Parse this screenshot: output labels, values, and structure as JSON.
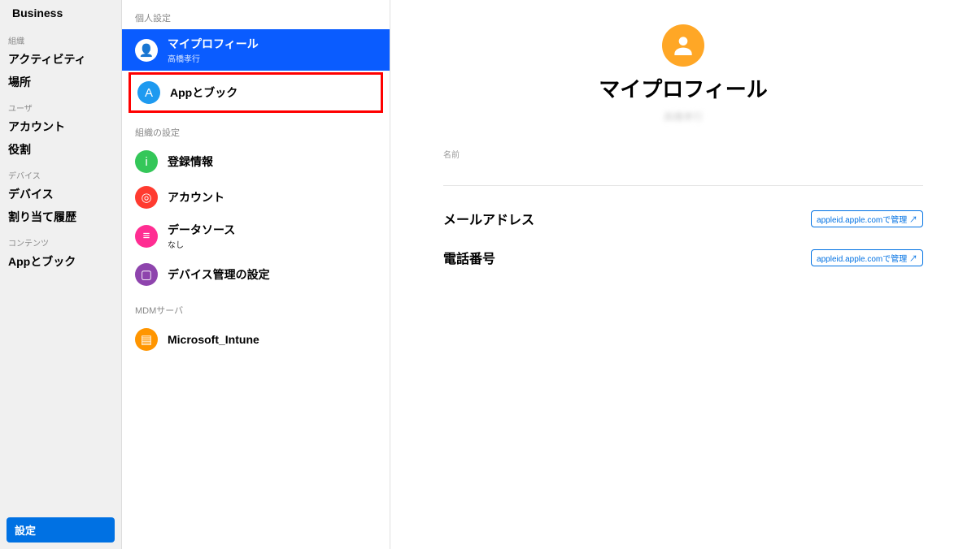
{
  "brand": "Business",
  "sidebar": {
    "sections": [
      {
        "header": "組織",
        "items": [
          "アクティビティ",
          "場所"
        ]
      },
      {
        "header": "ユーザ",
        "items": [
          "アカウント",
          "役割"
        ]
      },
      {
        "header": "デバイス",
        "items": [
          "デバイス",
          "割り当て履歴"
        ]
      },
      {
        "header": "コンテンツ",
        "items": [
          "Appとブック"
        ]
      }
    ],
    "settings_label": "設定"
  },
  "panel": {
    "sections": [
      {
        "header": "個人設定",
        "items": [
          {
            "title": "マイプロフィール",
            "sub": "高橋孝行",
            "icon": "person",
            "color": "#0a5cff",
            "active": true
          },
          {
            "title": "Appとブック",
            "sub": "",
            "icon": "appstore",
            "color": "#1e9af0",
            "highlighted": true
          }
        ]
      },
      {
        "header": "組織の設定",
        "items": [
          {
            "title": "登録情報",
            "sub": "",
            "icon": "info",
            "color": "#34c759"
          },
          {
            "title": "アカウント",
            "sub": "",
            "icon": "account",
            "color": "#ff3b30"
          },
          {
            "title": "データソース",
            "sub": "なし",
            "icon": "datasource",
            "color": "#ff2d92"
          },
          {
            "title": "デバイス管理の設定",
            "sub": "",
            "icon": "device",
            "color": "#8e44ad"
          }
        ]
      },
      {
        "header": "MDMサーバ",
        "items": [
          {
            "title": "Microsoft_Intune",
            "sub": "",
            "icon": "server",
            "color": "#ff9500"
          }
        ]
      }
    ]
  },
  "main": {
    "title": "マイプロフィール",
    "displayed_name": "高橋孝行",
    "name_label": "名前",
    "rows": [
      {
        "label": "メールアドレス",
        "link": "appleid.apple.comで管理 ↗"
      },
      {
        "label": "電話番号",
        "link": "appleid.apple.comで管理 ↗"
      }
    ]
  },
  "icon_glyphs": {
    "person": "👤",
    "appstore": "A",
    "info": "i",
    "account": "◎",
    "datasource": "≡",
    "device": "▢",
    "server": "▤"
  }
}
